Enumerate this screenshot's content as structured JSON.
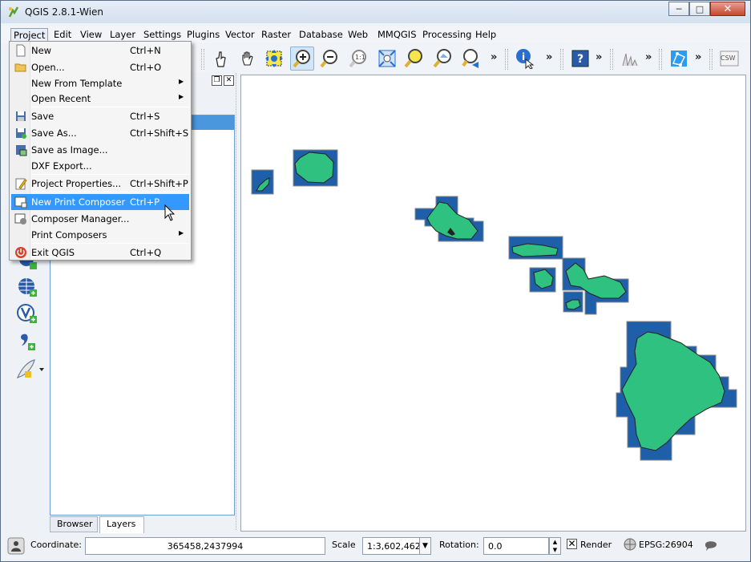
{
  "window": {
    "title": "QGIS 2.8.1-Wien"
  },
  "menubar": [
    {
      "label": "Project",
      "active": true
    },
    {
      "label": "Edit"
    },
    {
      "label": "View"
    },
    {
      "label": "Layer"
    },
    {
      "label": "Settings"
    },
    {
      "label": "Plugins"
    },
    {
      "label": "Vector"
    },
    {
      "label": "Raster"
    },
    {
      "label": "Database"
    },
    {
      "label": "Web"
    },
    {
      "label": "MMQGIS"
    },
    {
      "label": "Processing"
    },
    {
      "label": "Help"
    }
  ],
  "project_menu": [
    {
      "label": "New",
      "shortcut": "Ctrl+N",
      "icon": "new-file-icon"
    },
    {
      "label": "Open...",
      "shortcut": "Ctrl+O",
      "icon": "open-folder-icon"
    },
    {
      "label": "New From Template",
      "shortcut": "",
      "submenu": true
    },
    {
      "label": "Open Recent",
      "shortcut": "",
      "submenu": true
    },
    {
      "label": "Save",
      "shortcut": "Ctrl+S",
      "icon": "save-icon"
    },
    {
      "label": "Save As...",
      "shortcut": "Ctrl+Shift+S",
      "icon": "save-as-icon"
    },
    {
      "label": "Save as Image...",
      "shortcut": "",
      "icon": "save-image-icon"
    },
    {
      "label": "DXF Export...",
      "shortcut": ""
    },
    {
      "label": "Project Properties...",
      "shortcut": "Ctrl+Shift+P",
      "icon": "properties-icon"
    },
    {
      "label": "New Print Composer",
      "shortcut": "Ctrl+P",
      "icon": "print-composer-icon",
      "highlighted": true
    },
    {
      "label": "Composer Manager...",
      "shortcut": "",
      "icon": "composer-manager-icon"
    },
    {
      "label": "Print Composers",
      "shortcut": "",
      "submenu": true
    },
    {
      "label": "Exit QGIS",
      "shortcut": "Ctrl+Q",
      "icon": "exit-icon"
    }
  ],
  "panel_tabs": [
    {
      "label": "Browser"
    },
    {
      "label": "Layers",
      "active": true
    }
  ],
  "toolbar_icons": [
    "touch-icon",
    "pan-icon",
    "pan-to-selection-icon",
    "zoom-in-icon",
    "zoom-out-icon",
    "zoom-native-icon",
    "zoom-full-icon",
    "zoom-to-selection-icon",
    "zoom-to-layer-icon",
    "zoom-last-icon",
    "identify-icon",
    "help-icon",
    "profile-icon",
    "georeference-icon",
    "csw-icon"
  ],
  "toolbar_text": {
    "csw": "CSW",
    "more": "»"
  },
  "statusbar": {
    "coordinate_label": "Coordinate:",
    "coordinate_value": "365458,2437994",
    "scale_label": "Scale",
    "scale_value": "1:3,602,462",
    "rotation_label": "Rotation:",
    "rotation_value": "0.0",
    "render_label": "Render",
    "render_checked": true,
    "crs": "EPSG:26904"
  },
  "colors": {
    "land_fill": "#2fc17f",
    "tile_fill": "#1f5ea8",
    "menu_highlight": "#3399ff"
  }
}
